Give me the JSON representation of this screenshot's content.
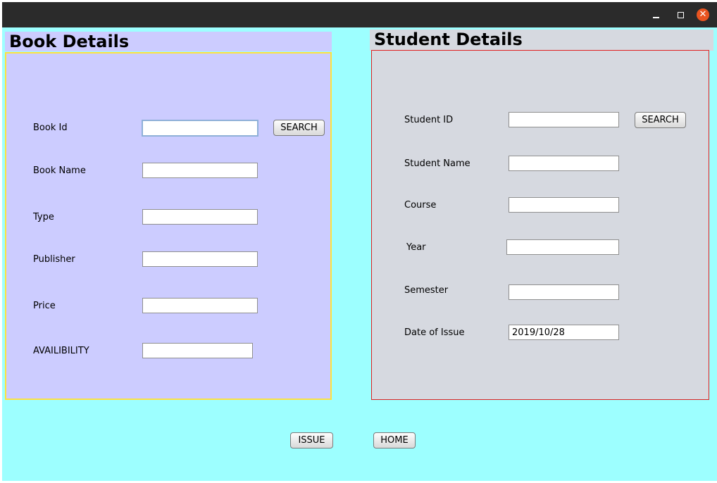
{
  "book": {
    "title": "Book Details",
    "labels": {
      "book_id": "Book Id",
      "book_name": "Book Name",
      "type": "Type",
      "publisher": "Publisher",
      "price": "Price",
      "availability": "AVAILIBILITY"
    },
    "values": {
      "book_id": "",
      "book_name": "",
      "type": "",
      "publisher": "",
      "price": "",
      "availability": ""
    },
    "search_label": "SEARCH"
  },
  "student": {
    "title": "Student Details",
    "labels": {
      "student_id": "Student ID",
      "student_name": "Student Name",
      "course": "Course",
      "year": "Year",
      "semester": "Semester",
      "date_of_issue": "Date of Issue"
    },
    "values": {
      "student_id": "",
      "student_name": "",
      "course": "",
      "year": "",
      "semester": "",
      "date_of_issue": "2019/10/28"
    },
    "search_label": "SEARCH"
  },
  "actions": {
    "issue_label": "ISSUE",
    "home_label": "HOME"
  },
  "window": {
    "minimize_icon": "minimize-icon",
    "maximize_icon": "maximize-icon",
    "close_icon": "close-icon"
  },
  "colors": {
    "background": "#9dffff",
    "book_panel": "#ccccff",
    "book_border": "#ffe13d",
    "student_panel": "#d6d9e0",
    "student_border": "#e02020",
    "close_button": "#e95420"
  }
}
